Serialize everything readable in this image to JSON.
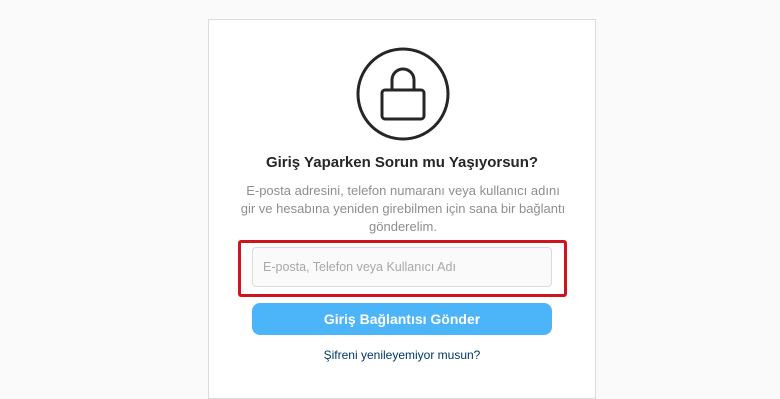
{
  "reset": {
    "icon": "lock-icon",
    "title": "Giriş Yaparken Sorun mu Yaşıyorsun?",
    "description": "E-posta adresini, telefon numaranı veya kullanıcı adını gir ve hesabına yeniden girebilmen için sana bir bağlantı gönderelim.",
    "input_placeholder": "E-posta, Telefon veya Kullanıcı Adı",
    "input_value": "",
    "send_button_label": "Giriş Bağlantısı Gönder",
    "cant_reset_link": "Şifreni yenileyemiyor musun?"
  },
  "colors": {
    "button": "#4cb5f9",
    "highlight_border": "#d0141d",
    "link": "#00376b"
  }
}
